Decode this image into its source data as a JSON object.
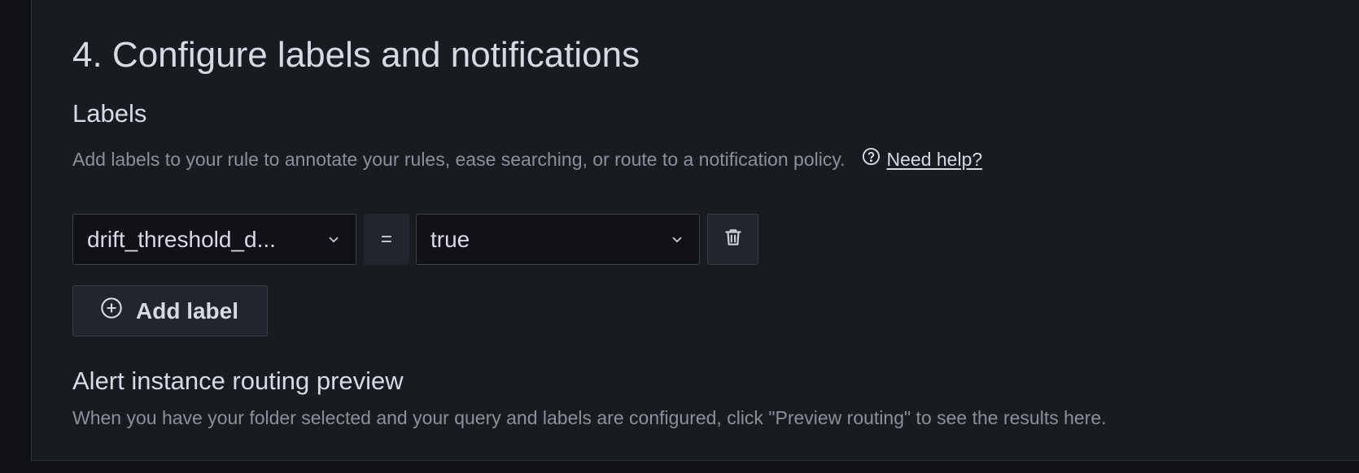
{
  "section": {
    "title": "4. Configure labels and notifications"
  },
  "labels": {
    "heading": "Labels",
    "description": "Add labels to your rule to annotate your rules, ease searching, or route to a notification policy.",
    "help_link": "Need help?",
    "rows": [
      {
        "key": "drift_threshold_d...",
        "operator": "=",
        "value": "true"
      }
    ],
    "add_button_label": "Add label"
  },
  "routing_preview": {
    "heading": "Alert instance routing preview",
    "description": "When you have your folder selected and your query and labels are configured, click \"Preview routing\" to see the results here."
  },
  "icons": {
    "help": "question-circle-icon",
    "chevron": "chevron-down-icon",
    "delete": "trash-icon",
    "add": "plus-circle-icon"
  },
  "colors": {
    "background": "#111217",
    "panel": "#181b1f",
    "text_primary": "#d8d9e3",
    "text_secondary": "#8e8f99",
    "button_bg": "#22252b"
  }
}
